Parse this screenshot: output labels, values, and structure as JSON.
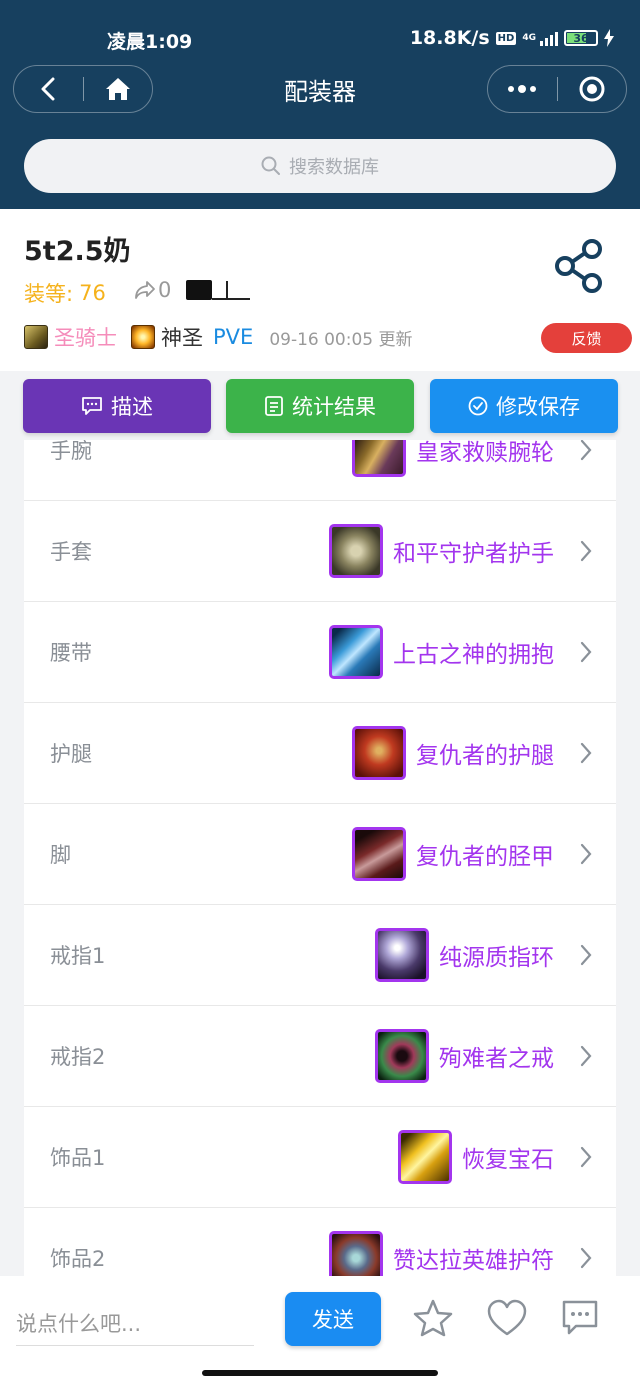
{
  "status": {
    "time": "凌晨1:09",
    "net_speed": "18.8K/s",
    "hd": "HD",
    "net_type": "4G",
    "battery": "36"
  },
  "nav": {
    "title": "配装器"
  },
  "search": {
    "placeholder": "搜索数据库"
  },
  "build": {
    "title": "5t2.5奶",
    "ilvl_label": "装等:",
    "ilvl_value": "76",
    "forward_count": "0",
    "class_name": "圣骑士",
    "spec_name": "神圣",
    "mode": "PVE",
    "updated": "09-16 00:05 更新",
    "feedback_label": "反馈"
  },
  "tabs": [
    {
      "label": "描述"
    },
    {
      "label": "统计结果"
    },
    {
      "label": "修改保存"
    }
  ],
  "gear": [
    {
      "slot": "手腕",
      "name": "皇家救赎腕轮"
    },
    {
      "slot": "手套",
      "name": "和平守护者护手"
    },
    {
      "slot": "腰带",
      "name": "上古之神的拥抱"
    },
    {
      "slot": "护腿",
      "name": "复仇者的护腿"
    },
    {
      "slot": "脚",
      "name": "复仇者的胫甲"
    },
    {
      "slot": "戒指1",
      "name": "纯源质指环"
    },
    {
      "slot": "戒指2",
      "name": "殉难者之戒"
    },
    {
      "slot": "饰品1",
      "name": "恢复宝石"
    },
    {
      "slot": "饰品2",
      "name": "赞达拉英雄护符"
    }
  ],
  "comment": {
    "placeholder": "说点什么吧...",
    "send_label": "发送"
  },
  "colors": {
    "header_bg": "#17405f",
    "epic": "#a335ee",
    "paladin": "#f58cba",
    "ilvl": "#f5b21c",
    "feedback": "#e4403b"
  }
}
